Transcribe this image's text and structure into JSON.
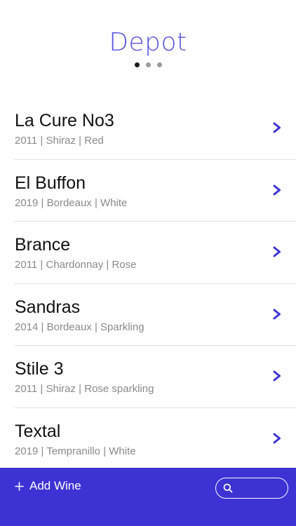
{
  "header": {
    "title": "Depot",
    "page_indicator": {
      "count": 3,
      "active_index": 0
    }
  },
  "wines": [
    {
      "name": "La Cure No3",
      "details": "2011 | Shiraz | Red"
    },
    {
      "name": "El Buffon",
      "details": "2019 | Bordeaux | White"
    },
    {
      "name": "Brance",
      "details": "2011 | Chardonnay | Rose"
    },
    {
      "name": "Sandras",
      "details": "2014 | Bordeaux | Sparkling"
    },
    {
      "name": "Stile 3",
      "details": "2011 | Shiraz | Rose sparkling"
    },
    {
      "name": "Textal",
      "details": "2019 | Tempranillo | White"
    }
  ],
  "bottom_bar": {
    "add_label": "Add Wine",
    "search_value": "",
    "add_icon": "plus-icon",
    "search_icon": "search-icon"
  },
  "colors": {
    "accent": "#5a55e0",
    "bar": "#3d32d4",
    "chevron": "#3d32d4"
  }
}
